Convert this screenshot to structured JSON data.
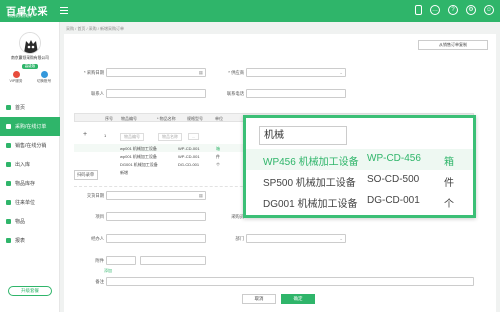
{
  "brand": {
    "name": "百卓优采",
    "tagline": "你的采购好助手",
    "color": "#2fb56a"
  },
  "topbar": {
    "icons": [
      "phone-icon",
      "message-icon",
      "help-icon",
      "settings-icon",
      "user-icon"
    ]
  },
  "sidebar": {
    "company": "南京赢领采购有限公司",
    "badge": "高级版",
    "quick": [
      {
        "label": "VIP服务",
        "color": "#e74c3c"
      },
      {
        "label": "切换账号",
        "color": "#3498db"
      }
    ],
    "nav": [
      {
        "label": "首页",
        "active": false
      },
      {
        "label": "采购/在线订单",
        "active": true
      },
      {
        "label": "销售/在线分销",
        "active": false
      },
      {
        "label": "出入库",
        "active": false
      },
      {
        "label": "物品库存",
        "active": false
      },
      {
        "label": "往来单位",
        "active": false
      },
      {
        "label": "物品",
        "active": false
      },
      {
        "label": "报表",
        "active": false
      }
    ],
    "upgrade": "升级套餐"
  },
  "breadcrumb": "采购 / 首页 / 采购 / 新增采购订单",
  "order_button": "从销售订单复制",
  "form": {
    "purchase_date": "* 采购日期",
    "supplier": "* 供应商",
    "contact": "联系人",
    "phone": "联系电话",
    "deliver_date": "交货日期",
    "project": "项目",
    "buyer": "采购员",
    "handler": "经办人",
    "department": "部门",
    "attachment": "附件",
    "add_link": "添加",
    "remark": "备注",
    "import_label": "扫码录单"
  },
  "table": {
    "headers": [
      "序号",
      "物品编号",
      "* 物品名称",
      "规格型号",
      "单位"
    ],
    "rows": [
      {
        "code": "物品编号",
        "name": "物品名称",
        "spec": "...",
        "unit": ""
      },
      {
        "code": "wp001 机械加工设备",
        "name": "WP-CD-001",
        "spec": "",
        "unit": "箱"
      },
      {
        "code": "wp001 机械加工设备",
        "name": "WP-CD-001",
        "spec": "",
        "unit": "件"
      },
      {
        "code": "DG001 机械加工设备",
        "name": "DG-CD-001",
        "spec": "",
        "unit": "个"
      },
      {
        "code": "新增",
        "name": "",
        "spec": "",
        "unit": ""
      }
    ]
  },
  "popup": {
    "query": "机械",
    "options": [
      {
        "code": "WP456 机械加工设备",
        "model": "WP-CD-456",
        "unit": "箱",
        "highlight": true
      },
      {
        "code": "SP500 机械加工设备",
        "model": "SO-CD-500",
        "unit": "件",
        "highlight": false
      },
      {
        "code": "DG001 机械加工设备",
        "model": "DG-CD-001",
        "unit": "个",
        "highlight": false
      }
    ]
  },
  "actions": {
    "cancel": "取消",
    "ok": "确定"
  }
}
